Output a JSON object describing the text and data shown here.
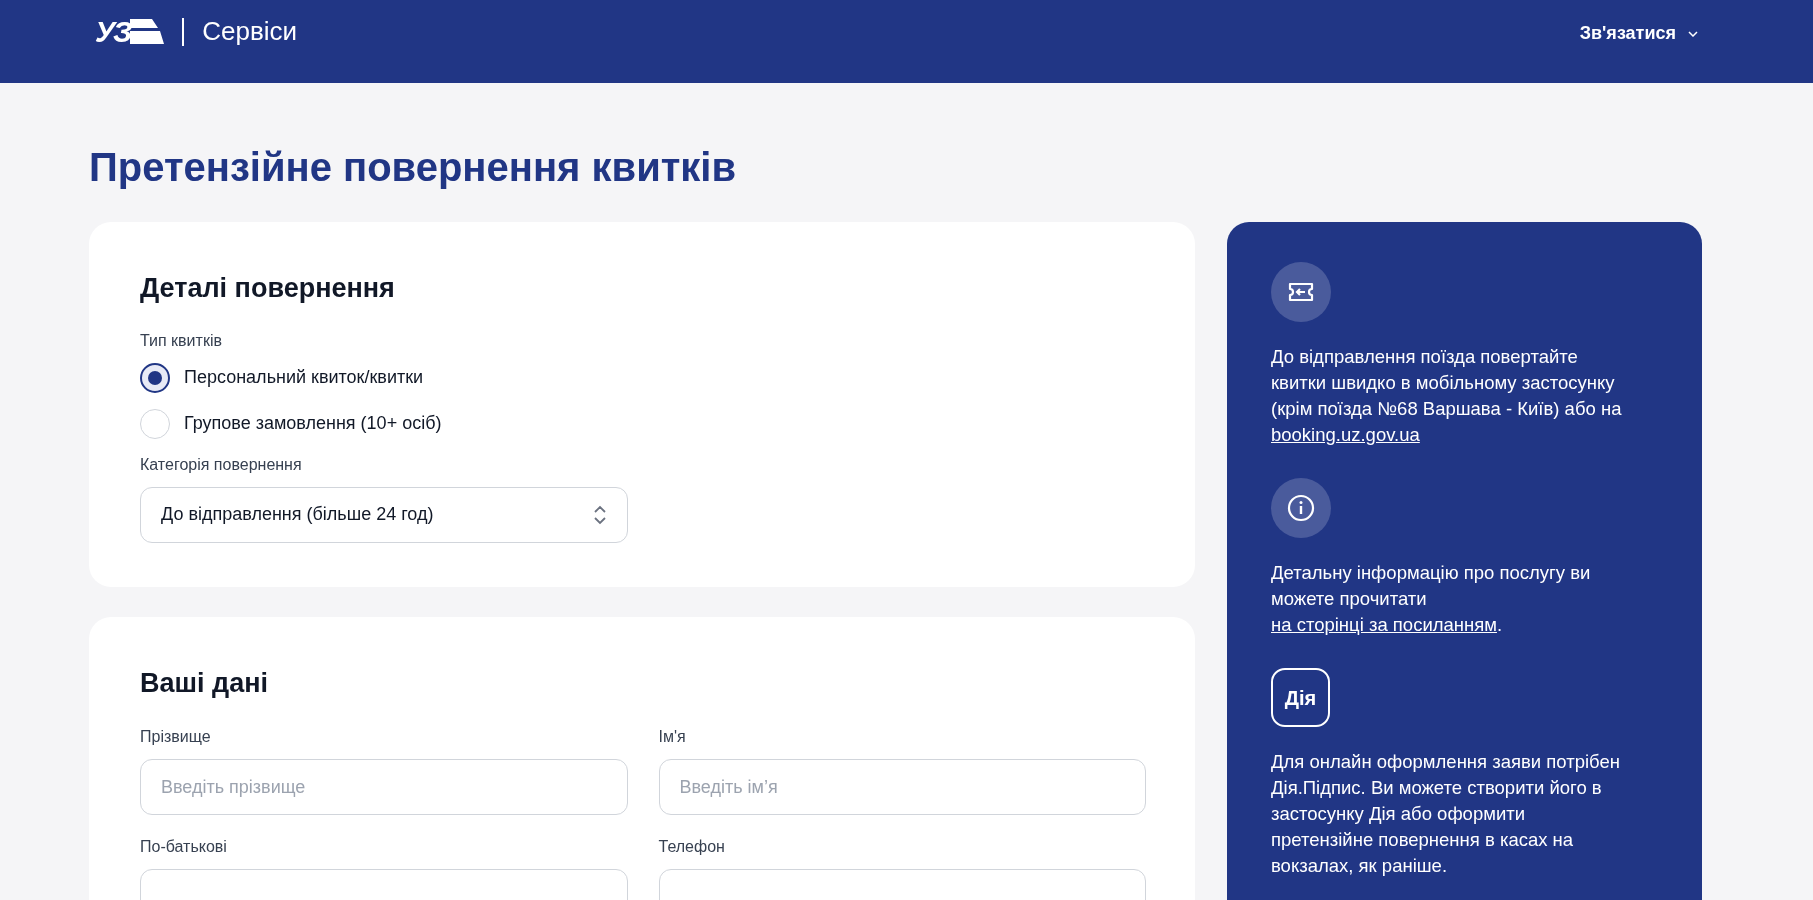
{
  "header": {
    "logo": "УЗ",
    "section": "Сервіси",
    "contact": "Зв'язатися"
  },
  "title": "Претензійне повернення квитків",
  "details": {
    "heading": "Деталі повернення",
    "ticket_type": {
      "label": "Тип квитків",
      "options": [
        {
          "label": "Персональний квиток/квитки",
          "selected": true
        },
        {
          "label": "Групове замовлення (10+ осіб)",
          "selected": false
        }
      ]
    },
    "category": {
      "label": "Категорія повернення",
      "value": "До відправлення (більше 24 год)"
    }
  },
  "personal": {
    "heading": "Ваші дані",
    "fields": [
      {
        "label": "Прізвище",
        "placeholder": "Введіть прізвище"
      },
      {
        "label": "Ім'я",
        "placeholder": "Введіть ім’я"
      },
      {
        "label": "По-батькові"
      },
      {
        "label": "Телефон"
      }
    ]
  },
  "info": [
    {
      "kind": "ticket",
      "text": "До відправлення поїзда повертайте квитки швидко в мобільному застосунку (крім поїзда №68 Варшава - Київ) або на ",
      "link": "booking.uz.gov.ua"
    },
    {
      "kind": "info",
      "text": "Детальну інформацію про послугу ви можете прочитати ",
      "link": "на сторінці за посиланням",
      "after": "."
    },
    {
      "kind": "diia",
      "badge": "Дія",
      "text": "Для онлайн оформлення заяви потрібен Дія.Підпис. Ви можете створити його в застосунку Дія або оформити претензійне повернення в касах на вокзалах, як раніше."
    }
  ]
}
